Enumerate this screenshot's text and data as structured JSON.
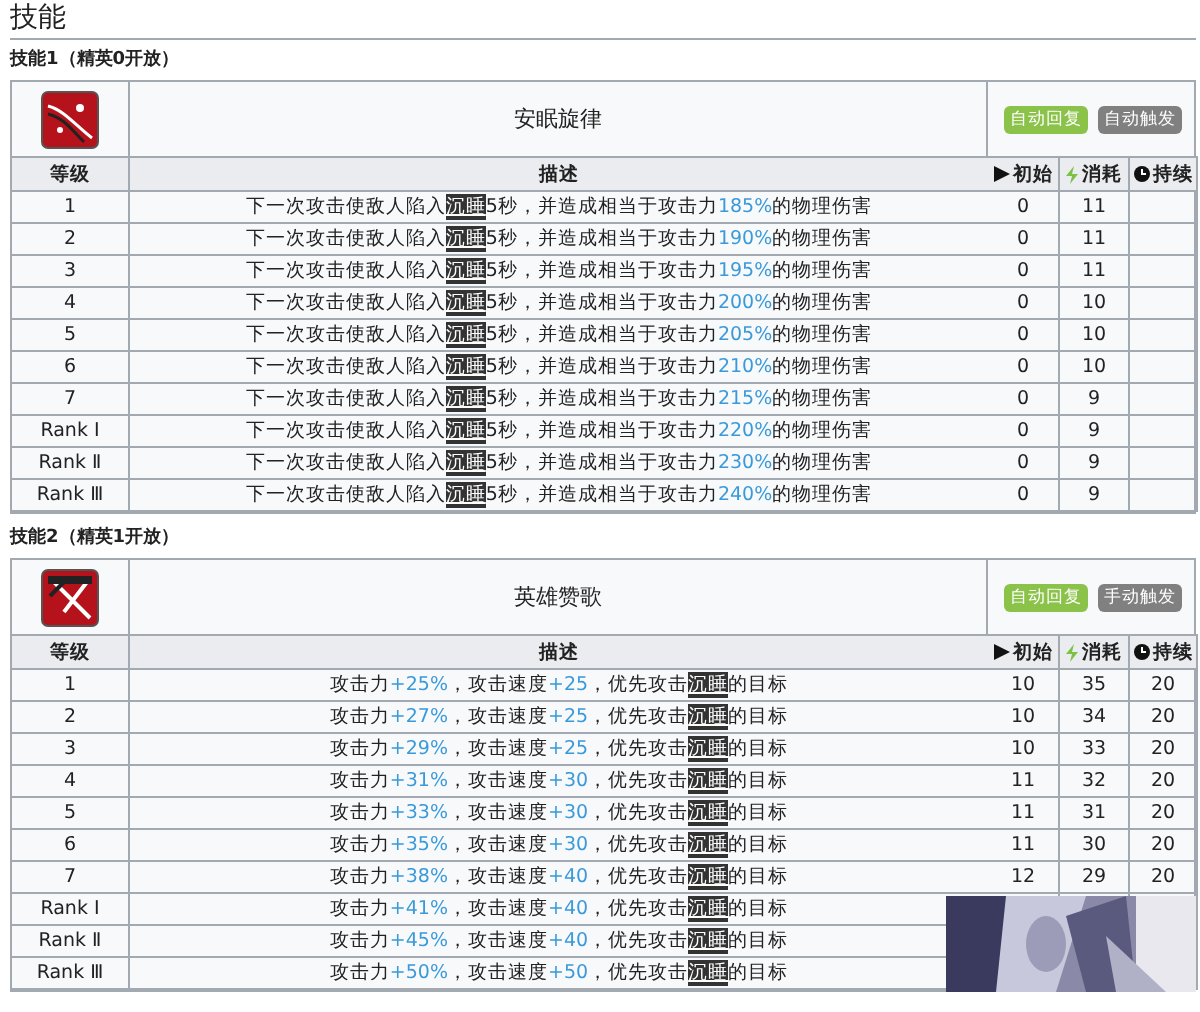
{
  "title": "技能",
  "skills": [
    {
      "label": "技能1（精英0开放）",
      "name": "安眠旋律",
      "tags": [
        {
          "text": "自动回复",
          "color": "#8bc34a"
        },
        {
          "text": "自动触发",
          "color": "#808080"
        }
      ],
      "columns": [
        {
          "label": "等级"
        },
        {
          "label": "描述"
        },
        {
          "label": "初始"
        },
        {
          "label": "消耗"
        },
        {
          "label": "持续"
        }
      ],
      "rows": [
        {
          "level": "1",
          "description": [
            {
              "kind": "text",
              "text": "下一次攻击使敌人陷入"
            },
            {
              "kind": "term",
              "text": "沉睡"
            },
            {
              "kind": "text",
              "text": "5秒，并造成相当于攻击力"
            },
            {
              "kind": "value",
              "text": "185%"
            },
            {
              "kind": "text",
              "text": "的物理伤害"
            }
          ],
          "initial": "0",
          "cost": "11"
        },
        {
          "level": "2",
          "description": [
            {
              "kind": "text",
              "text": "下一次攻击使敌人陷入"
            },
            {
              "kind": "term",
              "text": "沉睡"
            },
            {
              "kind": "text",
              "text": "5秒，并造成相当于攻击力"
            },
            {
              "kind": "value",
              "text": "190%"
            },
            {
              "kind": "text",
              "text": "的物理伤害"
            }
          ],
          "initial": "0",
          "cost": "11"
        },
        {
          "level": "3",
          "description": [
            {
              "kind": "text",
              "text": "下一次攻击使敌人陷入"
            },
            {
              "kind": "term",
              "text": "沉睡"
            },
            {
              "kind": "text",
              "text": "5秒，并造成相当于攻击力"
            },
            {
              "kind": "value",
              "text": "195%"
            },
            {
              "kind": "text",
              "text": "的物理伤害"
            }
          ],
          "initial": "0",
          "cost": "11"
        },
        {
          "level": "4",
          "description": [
            {
              "kind": "text",
              "text": "下一次攻击使敌人陷入"
            },
            {
              "kind": "term",
              "text": "沉睡"
            },
            {
              "kind": "text",
              "text": "5秒，并造成相当于攻击力"
            },
            {
              "kind": "value",
              "text": "200%"
            },
            {
              "kind": "text",
              "text": "的物理伤害"
            }
          ],
          "initial": "0",
          "cost": "10"
        },
        {
          "level": "5",
          "description": [
            {
              "kind": "text",
              "text": "下一次攻击使敌人陷入"
            },
            {
              "kind": "term",
              "text": "沉睡"
            },
            {
              "kind": "text",
              "text": "5秒，并造成相当于攻击力"
            },
            {
              "kind": "value",
              "text": "205%"
            },
            {
              "kind": "text",
              "text": "的物理伤害"
            }
          ],
          "initial": "0",
          "cost": "10"
        },
        {
          "level": "6",
          "description": [
            {
              "kind": "text",
              "text": "下一次攻击使敌人陷入"
            },
            {
              "kind": "term",
              "text": "沉睡"
            },
            {
              "kind": "text",
              "text": "5秒，并造成相当于攻击力"
            },
            {
              "kind": "value",
              "text": "210%"
            },
            {
              "kind": "text",
              "text": "的物理伤害"
            }
          ],
          "initial": "0",
          "cost": "10"
        },
        {
          "level": "7",
          "description": [
            {
              "kind": "text",
              "text": "下一次攻击使敌人陷入"
            },
            {
              "kind": "term",
              "text": "沉睡"
            },
            {
              "kind": "text",
              "text": "5秒，并造成相当于攻击力"
            },
            {
              "kind": "value",
              "text": "215%"
            },
            {
              "kind": "text",
              "text": "的物理伤害"
            }
          ],
          "initial": "0",
          "cost": "9"
        },
        {
          "level": "Rank Ⅰ",
          "description": [
            {
              "kind": "text",
              "text": "下一次攻击使敌人陷入"
            },
            {
              "kind": "term",
              "text": "沉睡"
            },
            {
              "kind": "text",
              "text": "5秒，并造成相当于攻击力"
            },
            {
              "kind": "value",
              "text": "220%"
            },
            {
              "kind": "text",
              "text": "的物理伤害"
            }
          ],
          "initial": "0",
          "cost": "9"
        },
        {
          "level": "Rank Ⅱ",
          "description": [
            {
              "kind": "text",
              "text": "下一次攻击使敌人陷入"
            },
            {
              "kind": "term",
              "text": "沉睡"
            },
            {
              "kind": "text",
              "text": "5秒，并造成相当于攻击力"
            },
            {
              "kind": "value",
              "text": "230%"
            },
            {
              "kind": "text",
              "text": "的物理伤害"
            }
          ],
          "initial": "0",
          "cost": "9"
        },
        {
          "level": "Rank Ⅲ",
          "description": [
            {
              "kind": "text",
              "text": "下一次攻击使敌人陷入"
            },
            {
              "kind": "term",
              "text": "沉睡"
            },
            {
              "kind": "text",
              "text": "5秒，并造成相当于攻击力"
            },
            {
              "kind": "value",
              "text": "240%"
            },
            {
              "kind": "text",
              "text": "的物理伤害"
            }
          ],
          "initial": "0",
          "cost": "9"
        }
      ]
    },
    {
      "label": "技能2（精英1开放）",
      "name": "英雄赞歌",
      "tags": [
        {
          "text": "自动回复",
          "color": "#8bc34a"
        },
        {
          "text": "手动触发",
          "color": "#808080"
        }
      ],
      "columns": [
        {
          "label": "等级"
        },
        {
          "label": "描述"
        },
        {
          "label": "初始"
        },
        {
          "label": "消耗"
        },
        {
          "label": "持续"
        }
      ],
      "rows": [
        {
          "level": "1",
          "description": [
            {
              "kind": "text",
              "text": "攻击力"
            },
            {
              "kind": "value",
              "text": "+25%"
            },
            {
              "kind": "text",
              "text": "，攻击速度"
            },
            {
              "kind": "value",
              "text": "+25"
            },
            {
              "kind": "text",
              "text": "，优先攻击"
            },
            {
              "kind": "term",
              "text": "沉睡"
            },
            {
              "kind": "text",
              "text": "的目标"
            }
          ],
          "initial": "10",
          "cost": "35",
          "duration": "20"
        },
        {
          "level": "2",
          "description": [
            {
              "kind": "text",
              "text": "攻击力"
            },
            {
              "kind": "value",
              "text": "+27%"
            },
            {
              "kind": "text",
              "text": "，攻击速度"
            },
            {
              "kind": "value",
              "text": "+25"
            },
            {
              "kind": "text",
              "text": "，优先攻击"
            },
            {
              "kind": "term",
              "text": "沉睡"
            },
            {
              "kind": "text",
              "text": "的目标"
            }
          ],
          "initial": "10",
          "cost": "34",
          "duration": "20"
        },
        {
          "level": "3",
          "description": [
            {
              "kind": "text",
              "text": "攻击力"
            },
            {
              "kind": "value",
              "text": "+29%"
            },
            {
              "kind": "text",
              "text": "，攻击速度"
            },
            {
              "kind": "value",
              "text": "+25"
            },
            {
              "kind": "text",
              "text": "，优先攻击"
            },
            {
              "kind": "term",
              "text": "沉睡"
            },
            {
              "kind": "text",
              "text": "的目标"
            }
          ],
          "initial": "10",
          "cost": "33",
          "duration": "20"
        },
        {
          "level": "4",
          "description": [
            {
              "kind": "text",
              "text": "攻击力"
            },
            {
              "kind": "value",
              "text": "+31%"
            },
            {
              "kind": "text",
              "text": "，攻击速度"
            },
            {
              "kind": "value",
              "text": "+30"
            },
            {
              "kind": "text",
              "text": "，优先攻击"
            },
            {
              "kind": "term",
              "text": "沉睡"
            },
            {
              "kind": "text",
              "text": "的目标"
            }
          ],
          "initial": "11",
          "cost": "32",
          "duration": "20"
        },
        {
          "level": "5",
          "description": [
            {
              "kind": "text",
              "text": "攻击力"
            },
            {
              "kind": "value",
              "text": "+33%"
            },
            {
              "kind": "text",
              "text": "，攻击速度"
            },
            {
              "kind": "value",
              "text": "+30"
            },
            {
              "kind": "text",
              "text": "，优先攻击"
            },
            {
              "kind": "term",
              "text": "沉睡"
            },
            {
              "kind": "text",
              "text": "的目标"
            }
          ],
          "initial": "11",
          "cost": "31",
          "duration": "20"
        },
        {
          "level": "6",
          "description": [
            {
              "kind": "text",
              "text": "攻击力"
            },
            {
              "kind": "value",
              "text": "+35%"
            },
            {
              "kind": "text",
              "text": "，攻击速度"
            },
            {
              "kind": "value",
              "text": "+30"
            },
            {
              "kind": "text",
              "text": "，优先攻击"
            },
            {
              "kind": "term",
              "text": "沉睡"
            },
            {
              "kind": "text",
              "text": "的目标"
            }
          ],
          "initial": "11",
          "cost": "30",
          "duration": "20"
        },
        {
          "level": "7",
          "description": [
            {
              "kind": "text",
              "text": "攻击力"
            },
            {
              "kind": "value",
              "text": "+38%"
            },
            {
              "kind": "text",
              "text": "，攻击速度"
            },
            {
              "kind": "value",
              "text": "+40"
            },
            {
              "kind": "text",
              "text": "，优先攻击"
            },
            {
              "kind": "term",
              "text": "沉睡"
            },
            {
              "kind": "text",
              "text": "的目标"
            }
          ],
          "initial": "12",
          "cost": "29",
          "duration": "20"
        },
        {
          "level": "Rank Ⅰ",
          "description": [
            {
              "kind": "text",
              "text": "攻击力"
            },
            {
              "kind": "value",
              "text": "+41%"
            },
            {
              "kind": "text",
              "text": "，攻击速度"
            },
            {
              "kind": "value",
              "text": "+40"
            },
            {
              "kind": "text",
              "text": "，优先攻击"
            },
            {
              "kind": "term",
              "text": "沉睡"
            },
            {
              "kind": "text",
              "text": "的目标"
            }
          ]
        },
        {
          "level": "Rank Ⅱ",
          "description": [
            {
              "kind": "text",
              "text": "攻击力"
            },
            {
              "kind": "value",
              "text": "+45%"
            },
            {
              "kind": "text",
              "text": "，攻击速度"
            },
            {
              "kind": "value",
              "text": "+40"
            },
            {
              "kind": "text",
              "text": "，优先攻击"
            },
            {
              "kind": "term",
              "text": "沉睡"
            },
            {
              "kind": "text",
              "text": "的目标"
            }
          ]
        },
        {
          "level": "Rank Ⅲ",
          "description": [
            {
              "kind": "text",
              "text": "攻击力"
            },
            {
              "kind": "value",
              "text": "+50%"
            },
            {
              "kind": "text",
              "text": "，攻击速度"
            },
            {
              "kind": "value",
              "text": "+50"
            },
            {
              "kind": "text",
              "text": "，优先攻击"
            },
            {
              "kind": "term",
              "text": "沉睡"
            },
            {
              "kind": "text",
              "text": "的目标"
            }
          ]
        }
      ]
    }
  ]
}
